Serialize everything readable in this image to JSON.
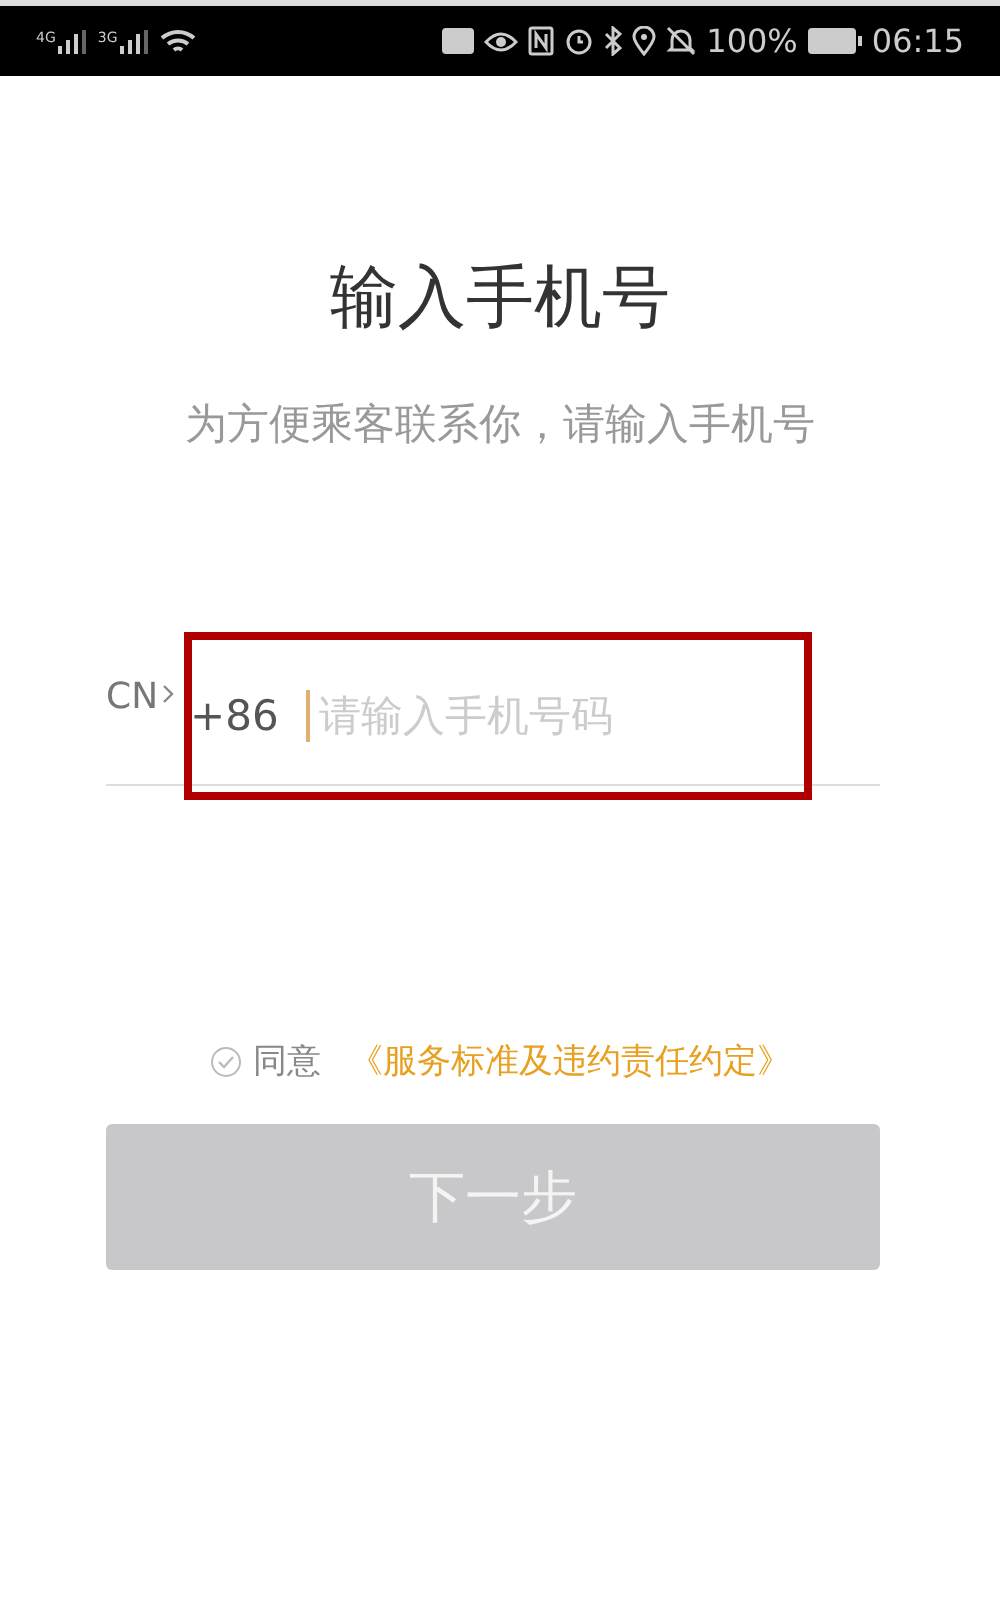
{
  "status_bar": {
    "signals": [
      {
        "label": "4G"
      },
      {
        "label": "3G"
      }
    ],
    "battery": "100%",
    "time": "06:15"
  },
  "title": "输入手机号",
  "subtitle": "为方便乘客联系你，请输入手机号",
  "phone": {
    "country": "CN",
    "code": "+86",
    "placeholder": "请输入手机号码",
    "highlighted": true
  },
  "agreement": {
    "checked": false,
    "label": "同意",
    "link": "《服务标准及违约责任约定》"
  },
  "next_button": {
    "label": "下一步",
    "disabled": true
  }
}
